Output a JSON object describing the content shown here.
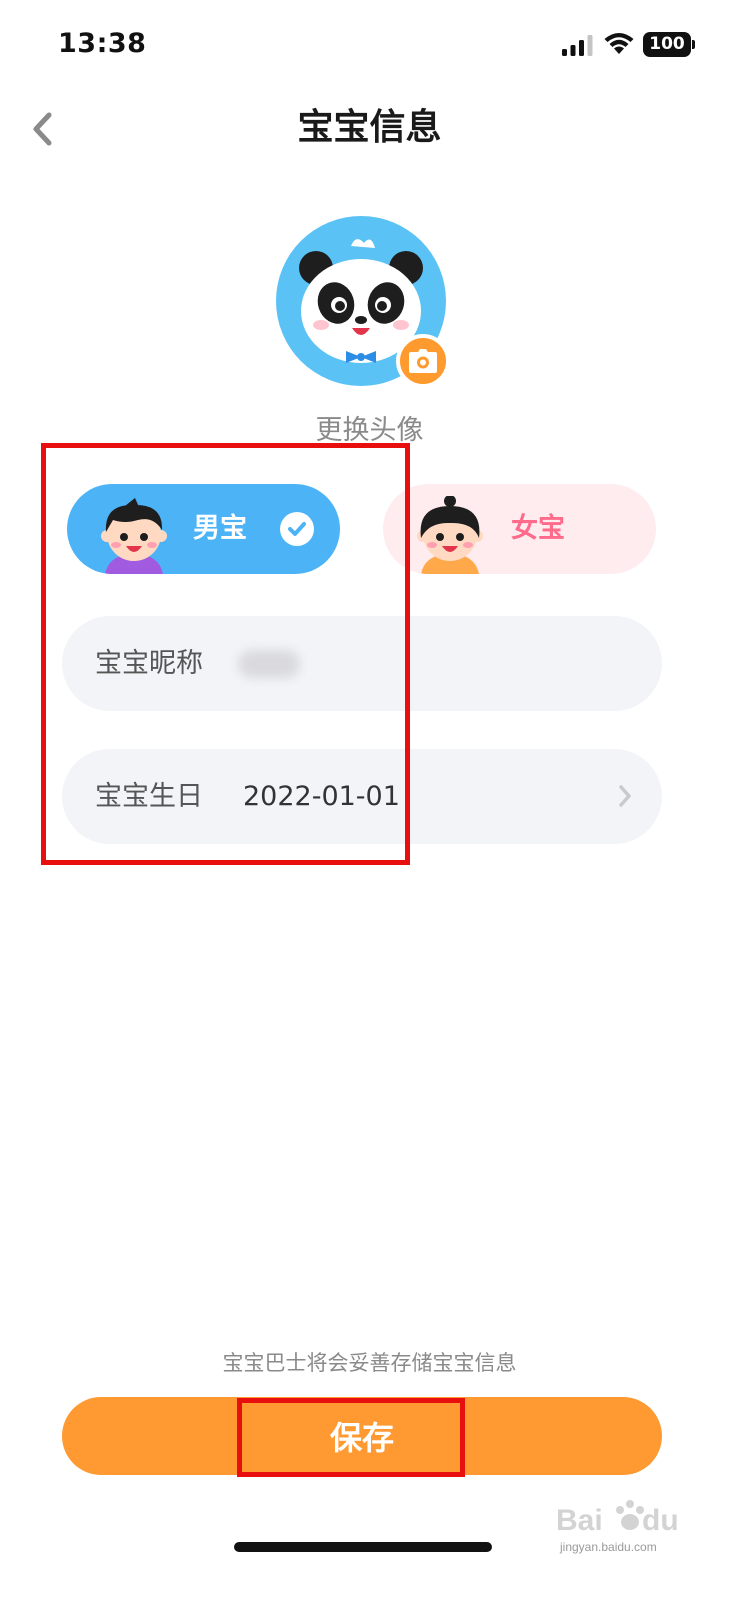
{
  "status_bar": {
    "time": "13:38",
    "battery": "100"
  },
  "header": {
    "title": "宝宝信息"
  },
  "avatar": {
    "change_label": "更换头像"
  },
  "gender": {
    "boy_label": "男宝",
    "girl_label": "女宝",
    "selected": "boy"
  },
  "form": {
    "nickname_label": "宝宝昵称",
    "nickname_value": "",
    "birthday_label": "宝宝生日",
    "birthday_value": "2022-01-01"
  },
  "footer": {
    "privacy_note": "宝宝巴士将会妥善存储宝宝信息",
    "save_label": "保存"
  },
  "watermark": {
    "text": "Baidu 经验",
    "url": "jingyan.baidu.com"
  },
  "colors": {
    "boy_blue": "#4db3f7",
    "girl_pink": "#ffecef",
    "girl_text": "#ff6b8b",
    "accent_orange": "#ff9a33",
    "field_bg": "#f3f4f8",
    "highlight_red": "#e8100e"
  }
}
